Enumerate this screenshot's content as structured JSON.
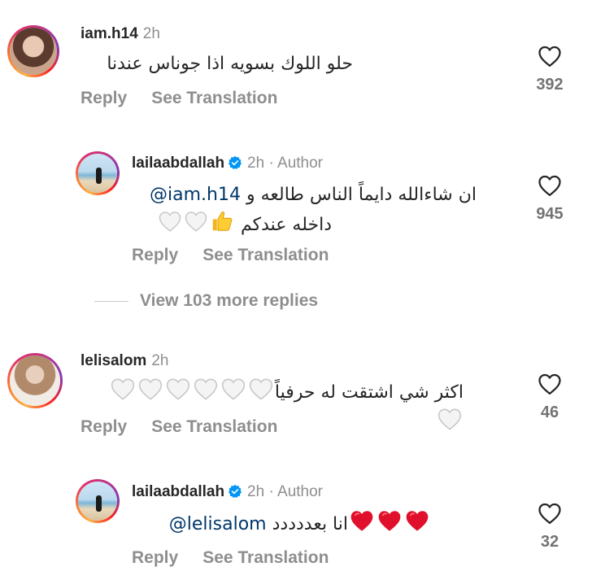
{
  "comments": [
    {
      "username": "iam.h14",
      "time": "2h",
      "text": "حلو اللوك بسويه اذا جوناس عندنا",
      "actions": {
        "reply": "Reply",
        "translate": "See Translation"
      },
      "likes": "392"
    },
    {
      "username": "lailaabdallah",
      "time": "2h",
      "author_label": "· Author",
      "mention": "@iam.h14",
      "text_line1": "ان شاءالله دايماً الناس طالعه و",
      "text_line2": "داخله عندكم",
      "actions": {
        "reply": "Reply",
        "translate": "See Translation"
      },
      "likes": "945"
    },
    {
      "view_more": "View 103 more replies"
    },
    {
      "username": "lelisalom",
      "time": "2h",
      "text": "اكثر شي اشتقت له حرفياً",
      "actions": {
        "reply": "Reply",
        "translate": "See Translation"
      },
      "likes": "46"
    },
    {
      "username": "lailaabdallah",
      "time": "2h",
      "author_label": "· Author",
      "mention": "@lelisalom",
      "text": "انا بعددددد",
      "actions": {
        "reply": "Reply",
        "translate": "See Translation"
      },
      "likes": "32"
    }
  ],
  "icons": {
    "heart_outline": "heart-outline-icon",
    "verified": "verified-badge-icon",
    "white_heart": "white-heart-emoji",
    "red_heart": "red-heart-emoji",
    "thumbs_up": "thumbs-up-emoji"
  },
  "colors": {
    "text": "#262626",
    "muted": "#8e8e8e",
    "verified": "#0095f6",
    "mention": "#00376b",
    "red_heart": "#e0102c"
  }
}
